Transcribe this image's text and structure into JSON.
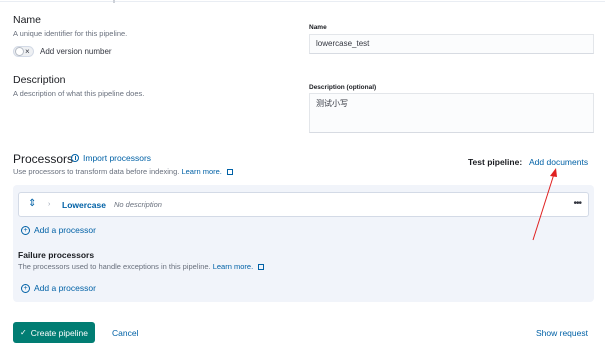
{
  "name_section": {
    "title": "Name",
    "description": "A unique identifier for this pipeline.",
    "toggle_label": "Add version number",
    "field_label": "Name",
    "field_value": "lowercase_test"
  },
  "description_section": {
    "title": "Description",
    "description": "A description of what this pipeline does.",
    "field_label": "Description (optional)",
    "field_value": "测试小写"
  },
  "processors": {
    "title": "Processors",
    "import_label": "Import processors",
    "description": "Use processors to transform data before indexing.",
    "learn_more": "Learn more.",
    "test_pipeline_label": "Test pipeline:",
    "add_documents": "Add documents",
    "items": [
      {
        "name": "Lowercase",
        "description": "No description"
      }
    ],
    "add_processor": "Add a processor"
  },
  "failure": {
    "title": "Failure processors",
    "description": "The processors used to handle exceptions in this pipeline.",
    "learn_more": "Learn more.",
    "add_processor": "Add a processor"
  },
  "footer": {
    "create_label": "Create pipeline",
    "cancel_label": "Cancel",
    "show_request_label": "Show request"
  },
  "colors": {
    "link": "#0061a6",
    "primary_button": "#017d73",
    "panel_bg": "#f1f4fa",
    "annotation": "#e02020"
  }
}
